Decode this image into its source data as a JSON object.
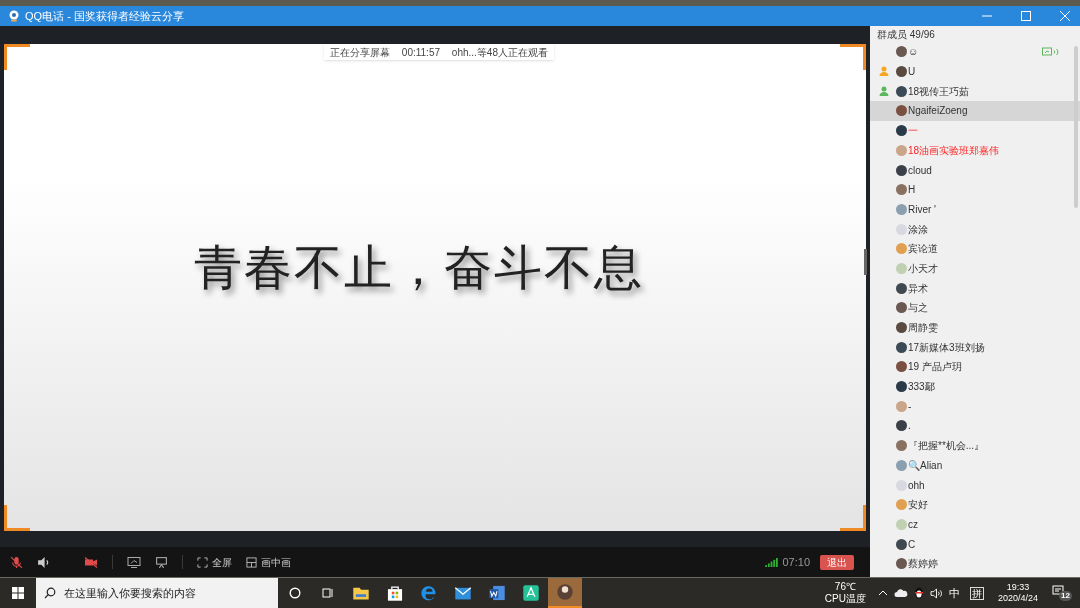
{
  "window": {
    "title": "QQ电话 - 国奖获得者经验云分享"
  },
  "share_banner": {
    "status": "正在分享屏幕",
    "duration": "00:11:57",
    "viewers": "ohh...等48人正在观看"
  },
  "slide": {
    "headline": "青春不止，奋斗不息"
  },
  "toolbar": {
    "controls": [
      {
        "kind": "mic",
        "on": false
      },
      {
        "kind": "speaker",
        "on": true
      },
      {
        "kind": "camera",
        "on": false
      },
      {
        "kind": "share",
        "on": true
      },
      {
        "kind": "whiteboard",
        "on": true
      },
      {
        "kind": "fullscreen",
        "label": "全屏"
      },
      {
        "kind": "pip",
        "label": "画中画"
      }
    ],
    "call_time": "07:10",
    "exit_label": "退出"
  },
  "members": {
    "title": "群成员 49/96",
    "items": [
      {
        "name": "☺",
        "owner": false,
        "admin": false,
        "sharing": true,
        "selected": false,
        "highlighted": false
      },
      {
        "name": "U",
        "owner": true,
        "admin": false,
        "sharing": false,
        "selected": false,
        "highlighted": false
      },
      {
        "name": "18视传王巧茹",
        "owner": false,
        "admin": true,
        "sharing": false,
        "selected": false,
        "highlighted": false
      },
      {
        "name": "NgaifeiZoeng",
        "owner": false,
        "admin": false,
        "sharing": false,
        "selected": true,
        "highlighted": false
      },
      {
        "name": "一",
        "owner": false,
        "admin": false,
        "sharing": false,
        "selected": false,
        "highlighted": true
      },
      {
        "name": "18油画实验班郑嘉伟",
        "owner": false,
        "admin": false,
        "sharing": false,
        "selected": false,
        "highlighted": true
      },
      {
        "name": "cloud",
        "owner": false,
        "admin": false,
        "sharing": false,
        "selected": false,
        "highlighted": false
      },
      {
        "name": "H",
        "owner": false,
        "admin": false,
        "sharing": false,
        "selected": false,
        "highlighted": false
      },
      {
        "name": "River '",
        "owner": false,
        "admin": false,
        "sharing": false,
        "selected": false,
        "highlighted": false
      },
      {
        "name": "涂涂",
        "owner": false,
        "admin": false,
        "sharing": false,
        "selected": false,
        "highlighted": false
      },
      {
        "name": "宾论道",
        "owner": false,
        "admin": false,
        "sharing": false,
        "selected": false,
        "highlighted": false
      },
      {
        "name": "小天才",
        "owner": false,
        "admin": false,
        "sharing": false,
        "selected": false,
        "highlighted": false
      },
      {
        "name": "异术",
        "owner": false,
        "admin": false,
        "sharing": false,
        "selected": false,
        "highlighted": false
      },
      {
        "name": "与之",
        "owner": false,
        "admin": false,
        "sharing": false,
        "selected": false,
        "highlighted": false
      },
      {
        "name": "周静雯",
        "owner": false,
        "admin": false,
        "sharing": false,
        "selected": false,
        "highlighted": false
      },
      {
        "name": "17新媒体3班刘扬",
        "owner": false,
        "admin": false,
        "sharing": false,
        "selected": false,
        "highlighted": false
      },
      {
        "name": "19 产品卢玥",
        "owner": false,
        "admin": false,
        "sharing": false,
        "selected": false,
        "highlighted": false
      },
      {
        "name": "333鄢",
        "owner": false,
        "admin": false,
        "sharing": false,
        "selected": false,
        "highlighted": false
      },
      {
        "name": "-",
        "owner": false,
        "admin": false,
        "sharing": false,
        "selected": false,
        "highlighted": false
      },
      {
        "name": ".",
        "owner": false,
        "admin": false,
        "sharing": false,
        "selected": false,
        "highlighted": false
      },
      {
        "name": "『把握**机会...』",
        "owner": false,
        "admin": false,
        "sharing": false,
        "selected": false,
        "highlighted": false
      },
      {
        "name": "🔍Alian",
        "owner": false,
        "admin": false,
        "sharing": false,
        "selected": false,
        "highlighted": false
      },
      {
        "name": "ohh",
        "owner": false,
        "admin": false,
        "sharing": false,
        "selected": false,
        "highlighted": false
      },
      {
        "name": "安好",
        "owner": false,
        "admin": false,
        "sharing": false,
        "selected": false,
        "highlighted": false
      },
      {
        "name": "cz",
        "owner": false,
        "admin": false,
        "sharing": false,
        "selected": false,
        "highlighted": false
      },
      {
        "name": "C",
        "owner": false,
        "admin": false,
        "sharing": false,
        "selected": false,
        "highlighted": false
      },
      {
        "name": "蔡婷婷",
        "owner": false,
        "admin": false,
        "sharing": false,
        "selected": false,
        "highlighted": false
      }
    ]
  },
  "taskbar": {
    "search": {
      "placeholder": "在这里输入你要搜索的内容"
    },
    "apps": [
      {
        "kind": "explorer",
        "active": false
      },
      {
        "kind": "store",
        "active": false
      },
      {
        "kind": "edge",
        "active": false
      },
      {
        "kind": "mail",
        "active": false
      },
      {
        "kind": "word",
        "active": false
      },
      {
        "kind": "pdf",
        "active": false
      },
      {
        "kind": "qq",
        "active": true
      }
    ],
    "temperature": "76℃",
    "temperature_label": "CPU温度",
    "ime_lang": "中",
    "ime_mode": "拼",
    "time": "19:33",
    "date": "2020/4/24",
    "notifications": "12"
  }
}
